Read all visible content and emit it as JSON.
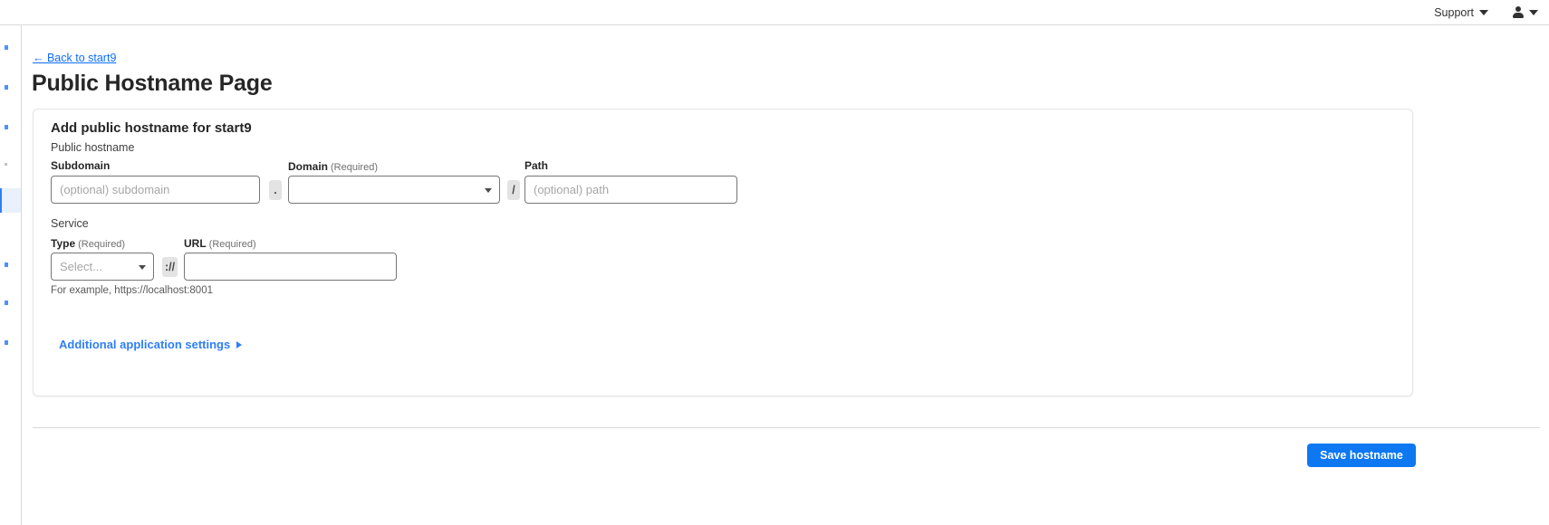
{
  "topbar": {
    "support_label": "Support",
    "support_icon": "chevron-down-icon",
    "account_icon": "user-avatar-icon",
    "account_caret_icon": "chevron-down-icon"
  },
  "sidebar": {
    "highlighted_item_index": 4,
    "icon_count": 8
  },
  "page": {
    "back_link": "← Back to start9",
    "title": "Public Hostname Page"
  },
  "card": {
    "title": "Add public hostname for start9",
    "hostname_section": {
      "label": "Public hostname",
      "subdomain": {
        "label": "Subdomain",
        "required_note": "",
        "placeholder": "(optional) subdomain",
        "value": ""
      },
      "dot_separator": ".",
      "domain": {
        "label": "Domain",
        "required_note": "(Required)",
        "value": "",
        "caret_icon": "chevron-down-icon"
      },
      "slash_separator": "/",
      "path": {
        "label": "Path",
        "required_note": "",
        "placeholder": "(optional) path",
        "value": ""
      }
    },
    "service_section": {
      "label": "Service",
      "type": {
        "label": "Type",
        "required_note": "(Required)",
        "value": "Select...",
        "caret_icon": "chevron-down-icon"
      },
      "protocol_separator": "://",
      "url": {
        "label": "URL",
        "required_note": "(Required)",
        "placeholder": "",
        "value": "",
        "helper_text": "For example, https://localhost:8001"
      }
    },
    "expand_link": {
      "label": "Additional application settings",
      "icon": "triangle-right-icon"
    }
  },
  "footer": {
    "save_label": "Save hostname"
  },
  "colors": {
    "accent_blue": "#0d78f2",
    "link_blue": "#2d7ff9",
    "border_gray": "#767676",
    "card_border": "#e4e4e4",
    "separator_bg": "#e3e3e3",
    "highlight_bg": "#e8f1fd"
  }
}
